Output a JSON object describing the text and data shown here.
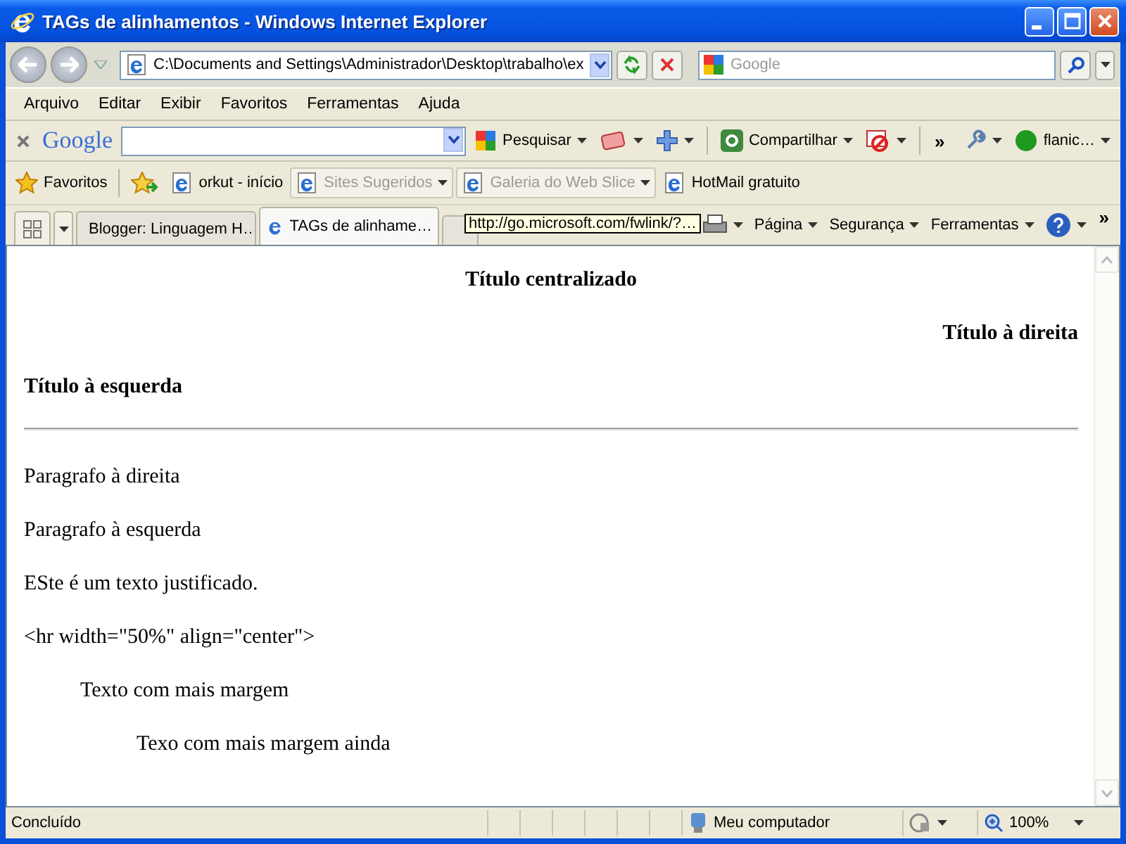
{
  "window": {
    "title": "TAGs de alinhamentos - Windows Internet Explorer"
  },
  "address_bar": {
    "value": "C:\\Documents and Settings\\Administrador\\Desktop\\trabalho\\ex"
  },
  "search": {
    "placeholder": "Google"
  },
  "menu": [
    "Arquivo",
    "Editar",
    "Exibir",
    "Favoritos",
    "Ferramentas",
    "Ajuda"
  ],
  "google_toolbar": {
    "logo": "Google",
    "search_button": "Pesquisar",
    "share_button": "Compartilhar",
    "overflow": "»",
    "account": "flanic…"
  },
  "favorites_bar": {
    "favorites_button": "Favoritos",
    "links": [
      {
        "label": "orkut - início",
        "disabled": false,
        "dropdown": false
      },
      {
        "label": "Sites Sugeridos",
        "disabled": true,
        "dropdown": true
      },
      {
        "label": "Galeria do Web Slice",
        "disabled": true,
        "dropdown": true
      },
      {
        "label": "HotMail gratuito",
        "disabled": false,
        "dropdown": false
      }
    ]
  },
  "tabs": [
    {
      "label": "Blogger: Linguagem H…",
      "selected": false
    },
    {
      "label": "TAGs de alinhame…",
      "selected": true
    }
  ],
  "tooltip": "http://go.microsoft.com/fwlink/?…",
  "command_bar": {
    "items": [
      "Página",
      "Segurança",
      "Ferramentas"
    ],
    "overflow": "»"
  },
  "content": [
    {
      "kind": "centered_heading",
      "text": "Título centralizado"
    },
    {
      "kind": "right_heading",
      "text": "Título à direita"
    },
    {
      "kind": "left_heading",
      "text": "Título à esquerda"
    },
    {
      "kind": "rule"
    },
    {
      "kind": "paragraph",
      "text": "Paragrafo à direita"
    },
    {
      "kind": "paragraph",
      "text": "Paragrafo à esquerda"
    },
    {
      "kind": "paragraph",
      "text": "ESte é um texto justificado."
    },
    {
      "kind": "paragraph",
      "text": "<hr width=\"50%\" align=\"center\">"
    },
    {
      "kind": "blockquote",
      "children": [
        {
          "kind": "paragraph",
          "text": "Texto com mais margem"
        },
        {
          "kind": "blockquote",
          "children": [
            {
              "kind": "paragraph",
              "text": "Texo com mais margem ainda"
            }
          ]
        }
      ]
    }
  ],
  "status_bar": {
    "status": "Concluído",
    "zone": "Meu computador",
    "zoom": "100%"
  }
}
